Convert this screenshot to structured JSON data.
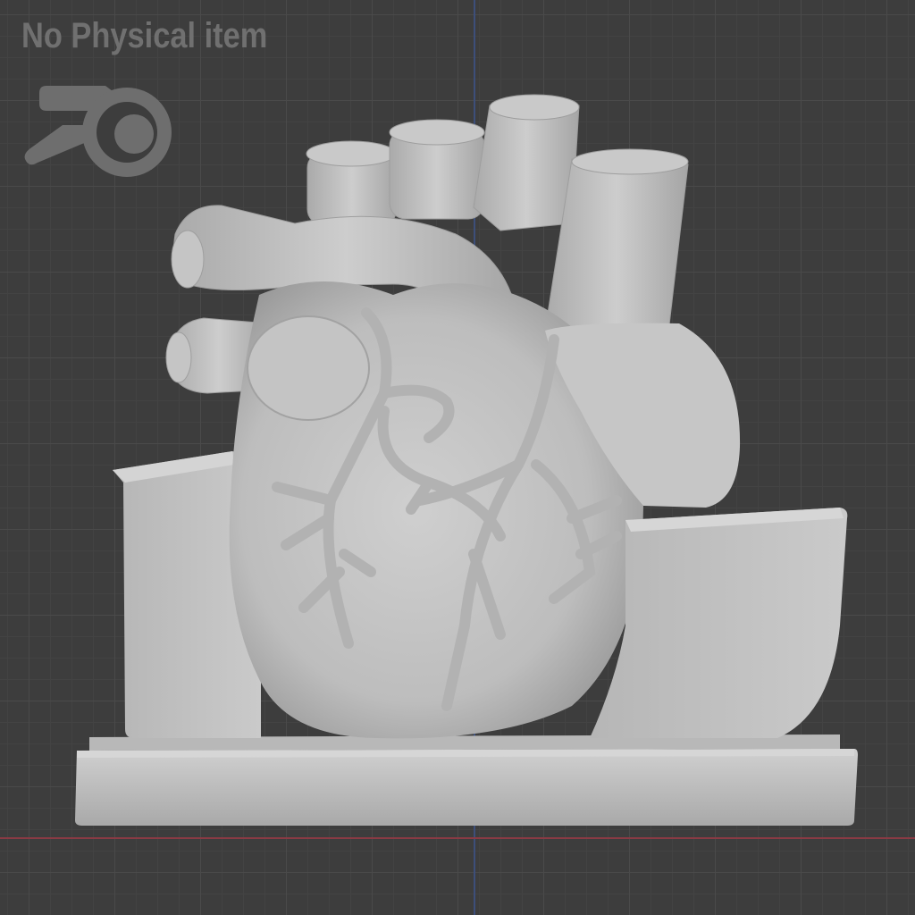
{
  "watermark": {
    "text": "No Physical item"
  },
  "logo": {
    "icon": "blender-logo-icon"
  },
  "viewport": {
    "background_color": "#3d3d3d",
    "grid_color": "#4a4a4a",
    "x_axis_color": "#8a3a44",
    "y_axis_color": "#3d4f7a",
    "model_color": "#c2c2c2"
  }
}
